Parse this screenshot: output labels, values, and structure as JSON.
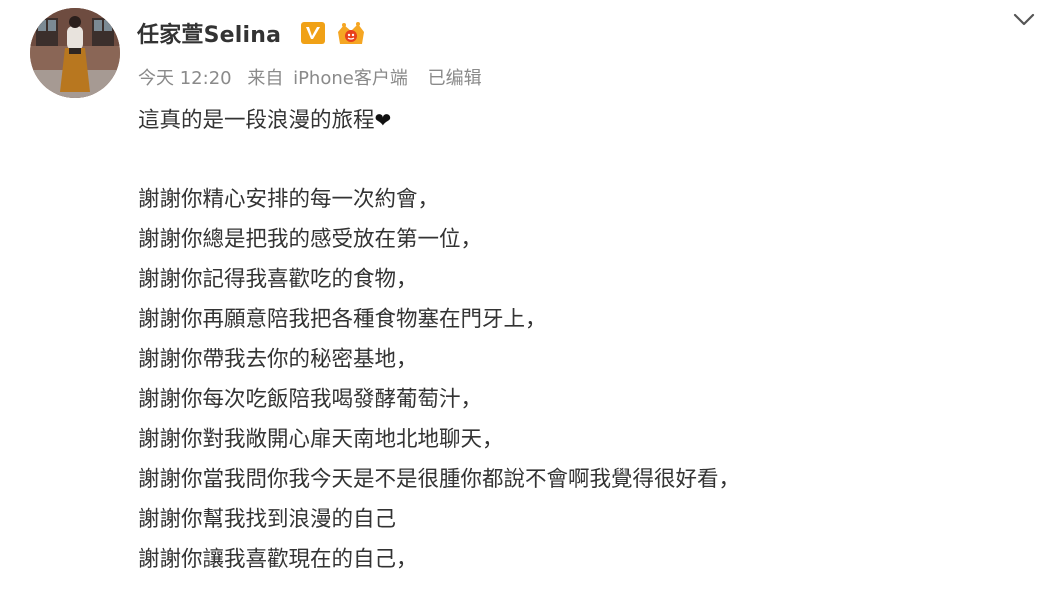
{
  "header": {
    "username": "任家萱Selina",
    "verified_badge": "V",
    "member_icon": "vip-crown-icon",
    "menu_icon": "chevron-down-icon"
  },
  "meta": {
    "time": "今天 12:20",
    "from_label": "来自",
    "source": "iPhone客户端",
    "edited": "已编辑"
  },
  "post": {
    "intro": "這真的是一段浪漫的旅程",
    "intro_suffix": "❤",
    "lines": [
      "謝謝你精心安排的每一次約會，",
      "謝謝你總是把我的感受放在第一位，",
      "謝謝你記得我喜歡吃的食物，",
      "謝謝你再願意陪我把各種食物塞在門牙上，",
      "謝謝你帶我去你的秘密基地，",
      "謝謝你每次吃飯陪我喝發酵葡萄汁，",
      "謝謝你對我敞開心扉天南地北地聊天，",
      "謝謝你當我問你我今天是不是很腫你都說不會啊我覺得很好看，",
      "謝謝你幫我找到浪漫的自己",
      "謝謝你讓我喜歡現在的自己，"
    ]
  },
  "colors": {
    "username": "#333333",
    "meta": "#8a8a8a",
    "verified_badge_bg": "#f0a116",
    "body_text": "#333333"
  }
}
